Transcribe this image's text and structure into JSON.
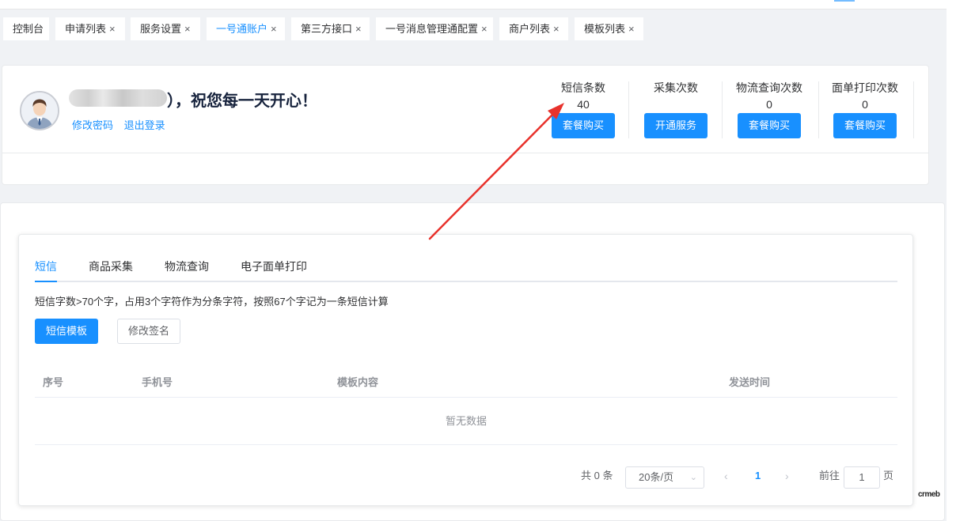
{
  "tags": [
    {
      "label": "控制台",
      "closable": false,
      "active": false
    },
    {
      "label": "申请列表",
      "closable": true,
      "active": false
    },
    {
      "label": "服务设置",
      "closable": true,
      "active": false
    },
    {
      "label": "一号通账户",
      "closable": true,
      "active": true
    },
    {
      "label": "第三方接口",
      "closable": true,
      "active": false
    },
    {
      "label": "一号消息管理通配置",
      "closable": true,
      "active": false
    },
    {
      "label": "商户列表",
      "closable": true,
      "active": false
    },
    {
      "label": "模板列表",
      "closable": true,
      "active": false
    }
  ],
  "close_glyph": "×",
  "user": {
    "greeting": "），祝您每一天开心！",
    "change_password": "修改密码",
    "logout": "退出登录"
  },
  "stats": [
    {
      "title": "短信条数",
      "value": "40",
      "button": "套餐购买"
    },
    {
      "title": "采集次数",
      "value": "",
      "button": "开通服务"
    },
    {
      "title": "物流查询次数",
      "value": "0",
      "button": "套餐购买"
    },
    {
      "title": "面单打印次数",
      "value": "0",
      "button": "套餐购买"
    }
  ],
  "tabs": [
    "短信",
    "商品采集",
    "物流查询",
    "电子面单打印"
  ],
  "active_tab": "短信",
  "tip": "短信字数>70个字，占用3个字符作为分条字符，按照67个字记为一条短信计算",
  "buttons": {
    "sms_template": "短信模板",
    "edit_signature": "修改签名"
  },
  "table": {
    "columns": [
      "序号",
      "手机号",
      "模板内容",
      "发送时间"
    ],
    "empty_text": "暂无数据"
  },
  "pagination": {
    "total": "共 0 条",
    "page_size": "20条/页",
    "current_page": "1",
    "goto_prefix": "前往",
    "goto_value": "1",
    "goto_suffix": "页"
  },
  "annotation": {
    "color": "#e8322c"
  },
  "logo": "crmeb",
  "colors": {
    "primary": "#1890ff",
    "background": "#f0f2f5"
  }
}
